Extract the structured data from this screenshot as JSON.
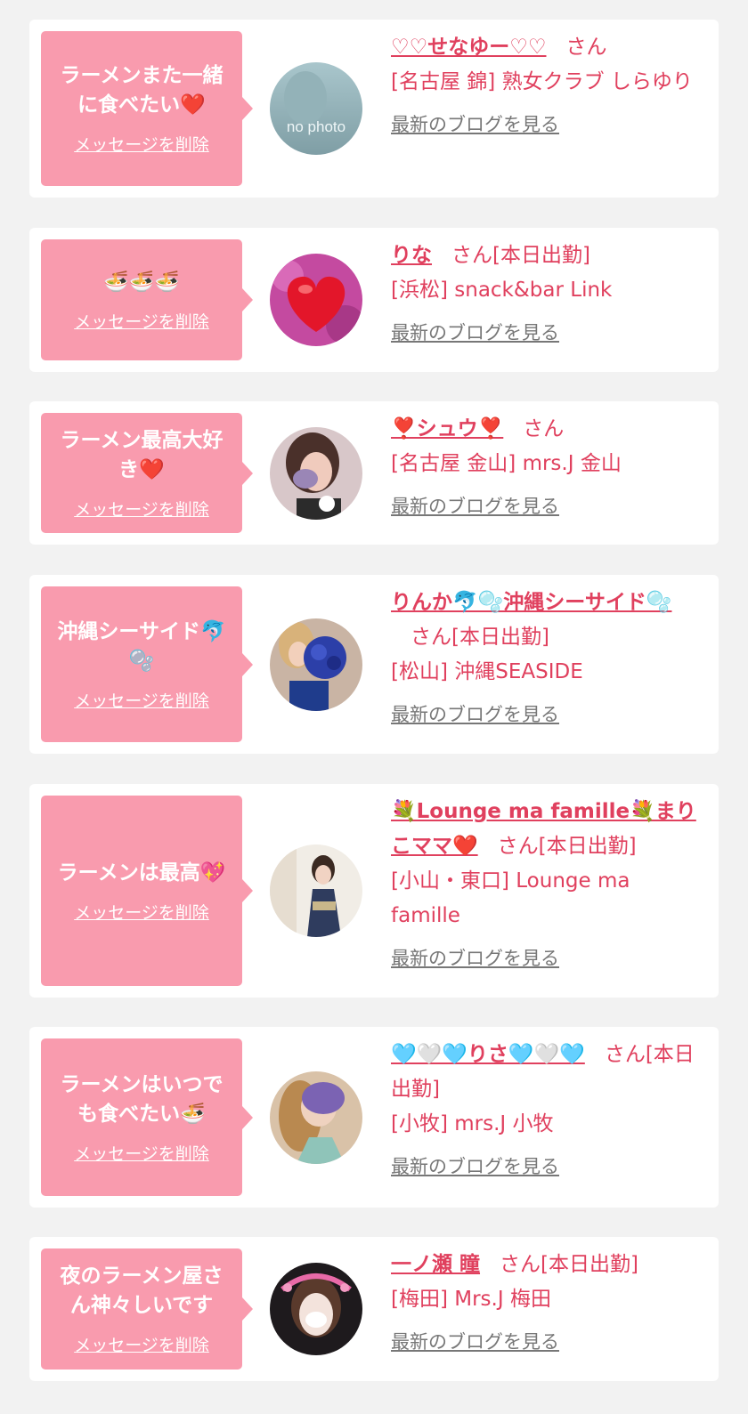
{
  "colors": {
    "accent": "#e0405e",
    "bubble": "#f99bae",
    "link_gray": "#777777",
    "background": "#f2f2f2"
  },
  "delete_label": "メッセージを削除",
  "blog_label": "最新のブログを見る",
  "san_label": "さん",
  "cards": [
    {
      "message": "ラーメンまた一緒に食べたい❤️",
      "name": "♡♡せなゆー♡♡",
      "shift": "",
      "shop": "[名古屋 錦] 熟女クラブ しらゆり",
      "avatar": "no-photo",
      "avatar_text": "no photo"
    },
    {
      "message": "🍜🍜🍜",
      "name": "りな",
      "shift": "[本日出勤]",
      "shop": "[浜松] snack&bar Link",
      "avatar": "heart-photo"
    },
    {
      "message": "ラーメン最高大好き❤️",
      "name": "❣️シュウ❣️",
      "shift": "",
      "shop": "[名古屋 金山] mrs.J 金山",
      "avatar": "woman-photo"
    },
    {
      "message": "沖縄シーサイド🐬🫧",
      "name": "りんか🐬🫧沖縄シーサイド🫧",
      "shift": "[本日出勤]",
      "shop": "[松山] 沖縄SEASIDE",
      "avatar": "bouquet-photo"
    },
    {
      "message": "ラーメンは最高💖",
      "name": "💐Lounge ma famille💐まりこママ❤️",
      "shift": "[本日出勤]",
      "shop": "[小山・東口] Lounge ma famille",
      "avatar": "kimono-photo"
    },
    {
      "message": "ラーメンはいつでも食べたい🍜",
      "name": "🩵🤍🩵りさ🩵🤍🩵",
      "shift": "[本日出勤]",
      "shop": "[小牧] mrs.J 小牧",
      "avatar": "woman-photo-2"
    },
    {
      "message": "夜のラーメン屋さん神々しいです",
      "name": "一ノ瀬 瞳",
      "shift": "[本日出勤]",
      "shop": "[梅田] Mrs.J 梅田",
      "avatar": "portrait-photo"
    }
  ]
}
